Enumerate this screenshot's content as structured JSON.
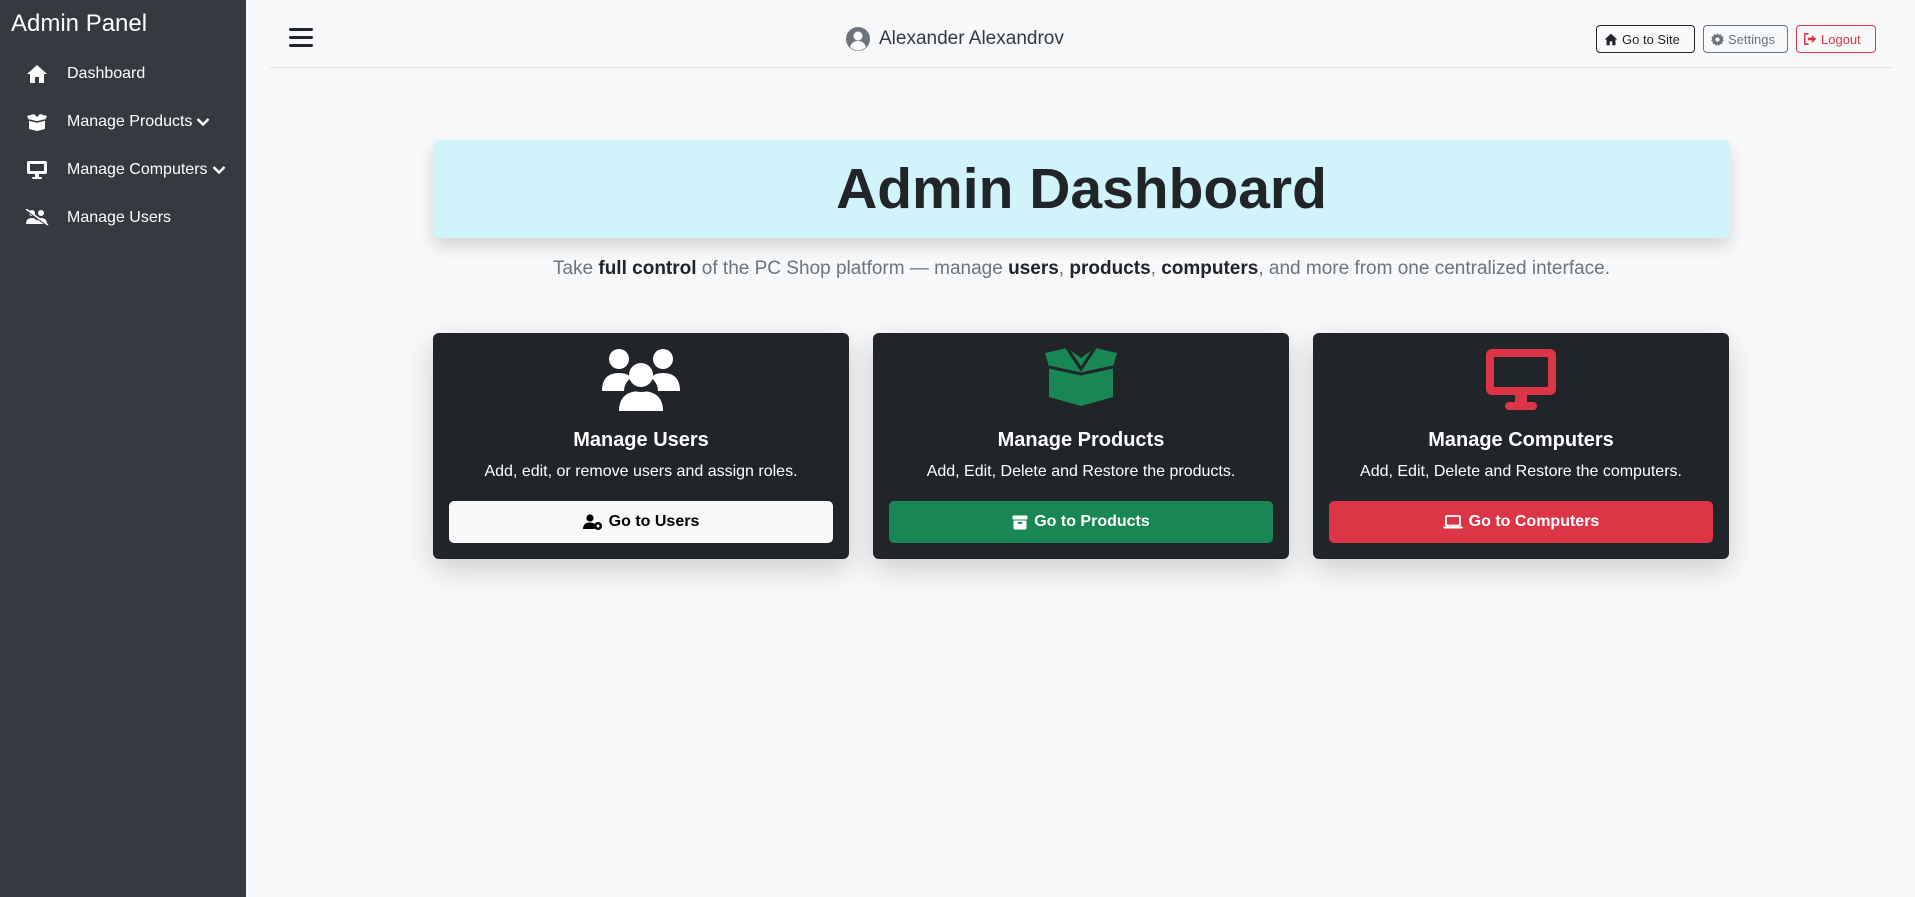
{
  "sidebar": {
    "title": "Admin Panel",
    "items": [
      {
        "label": "Dashboard",
        "icon": "home-icon"
      },
      {
        "label": "Manage Products",
        "icon": "box-icon"
      },
      {
        "label": "Manage Computers",
        "icon": "desktop-icon"
      },
      {
        "label": "Manage Users",
        "icon": "users-icon"
      }
    ]
  },
  "header": {
    "user_name": "Alexander Alexandrov",
    "go_to_site": "Go to Site",
    "settings": "Settings",
    "logout": "Logout"
  },
  "main": {
    "title": "Admin Dashboard",
    "lead": {
      "t1": "Take ",
      "b1": "full control",
      "t2": " of the PC Shop platform — manage ",
      "b2": "users",
      "t3": ", ",
      "b3": "products",
      "t4": ", ",
      "b4": "computers",
      "t5": ", and more from one centralized interface."
    },
    "cards": [
      {
        "title": "Manage Users",
        "desc": "Add, edit, or remove users and assign roles.",
        "button": "Go to Users",
        "icon": "users-icon",
        "color": "#ffffff"
      },
      {
        "title": "Manage Products",
        "desc": "Add, Edit, Delete and Restore the products.",
        "button": "Go to Products",
        "icon": "open-box-icon",
        "color": "#198754"
      },
      {
        "title": "Manage Computers",
        "desc": "Add, Edit, Delete and Restore the computers.",
        "button": "Go to Computers",
        "icon": "monitor-icon",
        "color": "#dc3545"
      }
    ]
  },
  "colors": {
    "sidebar_bg": "#343a40",
    "hero_bg": "#cff4fc",
    "card_bg": "#212529",
    "success": "#198754",
    "danger": "#dc3545",
    "secondary": "#6c757d"
  }
}
